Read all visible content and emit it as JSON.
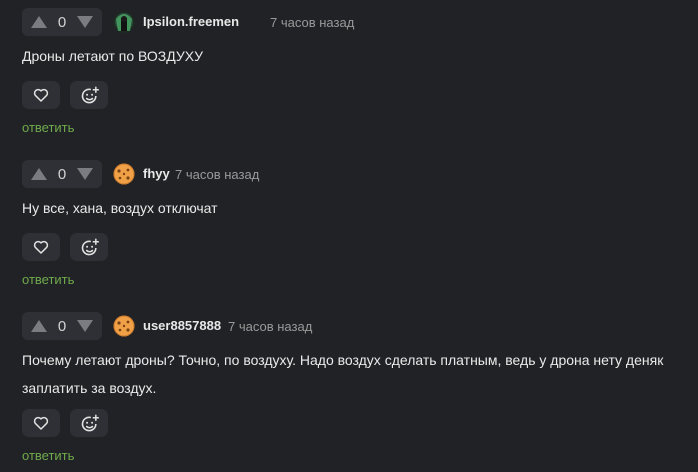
{
  "actions": {
    "reply_label": "ответить"
  },
  "colors": {
    "background": "#212226",
    "button_bg": "#2f3035",
    "reply_link": "#6fab4c",
    "muted_text": "#9a9a9a"
  },
  "comments": [
    {
      "author": "Ipsilon.freemen",
      "time": "7 часов назад",
      "rating": "0",
      "avatar": "dark-green-avatar",
      "text_lines": [
        "Дроны летают по ВОЗДУХУ"
      ]
    },
    {
      "author": "fhyy",
      "time": "7 часов назад",
      "rating": "0",
      "avatar": "orange-cookie-avatar",
      "text_lines": [
        "Ну все, хана, воздух отключат"
      ]
    },
    {
      "author": "user8857888",
      "time": "7 часов назад",
      "rating": "0",
      "avatar": "orange-cookie-avatar",
      "text_lines": [
        "Почему летают дроны? Точно, по воздуху. Надо воздух сделать платным, ведь у дрона нету деняк",
        "заплатить за воздух."
      ]
    }
  ]
}
